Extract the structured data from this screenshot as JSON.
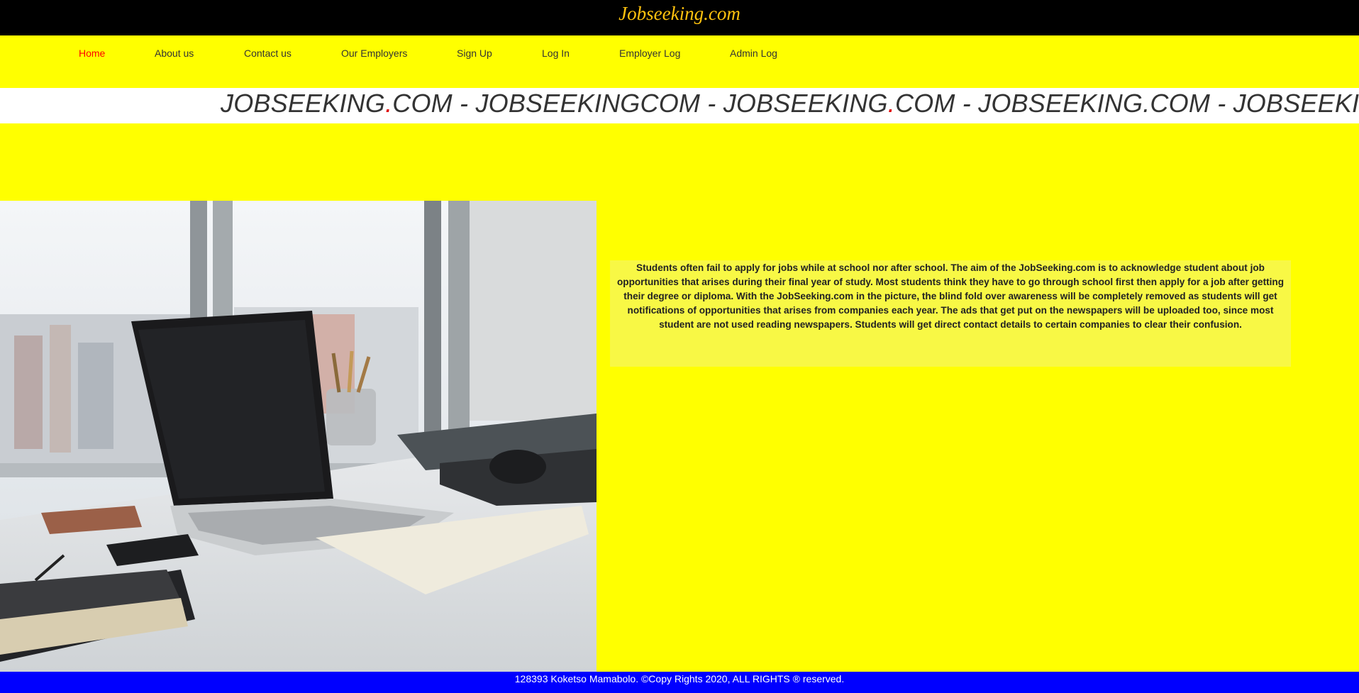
{
  "header": {
    "brand": "Jobseeking.com"
  },
  "nav": {
    "items": [
      {
        "label": "Home",
        "active": true
      },
      {
        "label": "About us"
      },
      {
        "label": "Contact us"
      },
      {
        "label": "Our Employers"
      },
      {
        "label": "Sign Up"
      },
      {
        "label": "Log In"
      },
      {
        "label": "Employer Log"
      },
      {
        "label": "Admin Log"
      }
    ]
  },
  "marquee": {
    "parts": [
      "JOBSEEKING",
      ".",
      "COM - JOBSEEKINGCOM - JOBSEEKING",
      ".",
      "COM - JOBSEEKING.COM - JOBSEEKING"
    ]
  },
  "hero": {
    "image": "laptop-desk-office-photo"
  },
  "about": {
    "text": "Students often fail to apply for jobs while at school nor after school. The aim of the JobSeeking.com is to acknowledge student about job opportunities that arises during their final year of study. Most students think they have to go through school first then apply for a job after getting their degree or diploma. With the JobSeeking.com in the picture, the blind fold over awareness will be completely removed as students will get notifications of opportunities that arises from companies each year. The ads that get put on the newspapers will be uploaded too, since most student are not used reading newspapers. Students will get direct contact details to certain companies to clear their confusion."
  },
  "footer": {
    "text": "128393 Koketso Mamabolo. ©Copy Rights 2020, ALL RIGHTS ® reserved."
  },
  "colors": {
    "page_bg": "#ffff00",
    "header_bg": "#000000",
    "brand": "#ffc20e",
    "footer_bg": "#0000ff",
    "active_nav": "#ff0000"
  }
}
